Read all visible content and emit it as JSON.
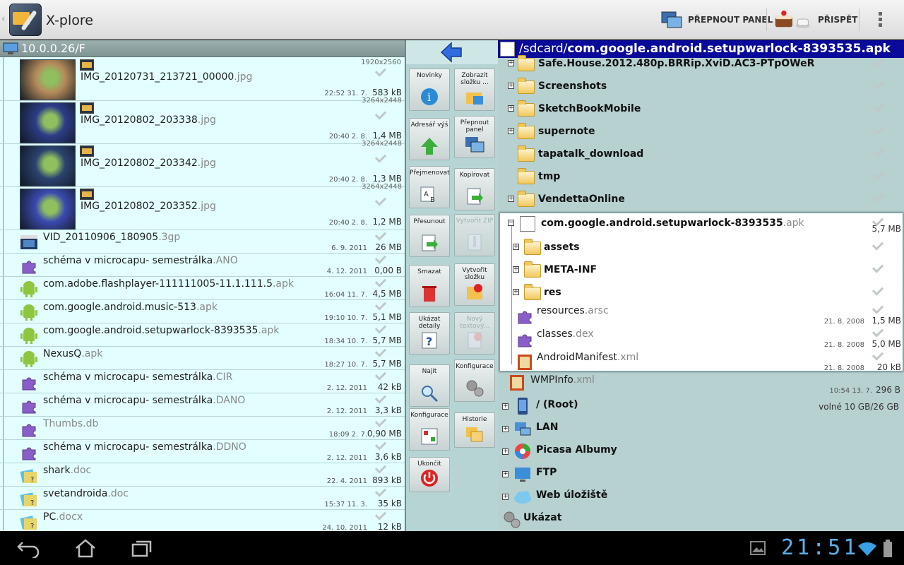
{
  "app": {
    "title": "X-plore"
  },
  "actionbar": {
    "switch_panel": "PŘEPNOUT PANEL",
    "donate": "PŘISPĚT"
  },
  "left_panel": {
    "path": "10.0.0.26/F",
    "top_resolution": "1920x2560",
    "rows": [
      {
        "name": "IMG_20120731_213721_00000",
        "ext": ".jpg",
        "date": "22:52 31. 7.",
        "size": "583 kB",
        "res": "3264x2448",
        "type": "photo"
      },
      {
        "name": "IMG_20120802_203338",
        "ext": ".jpg",
        "date": "20:40 2. 8.",
        "size": "1,4 MB",
        "res": "3264x2448",
        "type": "photo"
      },
      {
        "name": "IMG_20120802_203342",
        "ext": ".jpg",
        "date": "20:40 2. 8.",
        "size": "1,3 MB",
        "res": "3264x2448",
        "type": "photo"
      },
      {
        "name": "IMG_20120802_203352",
        "ext": ".jpg",
        "date": "20:40 2. 8.",
        "size": "1,2 MB",
        "res": "",
        "type": "photo"
      },
      {
        "name": "VID_20110906_180905",
        "ext": ".3gp",
        "date": "6. 9. 2011",
        "size": "26 MB",
        "type": "video"
      },
      {
        "name": "schéma v microcapu- semestrálka",
        "ext": ".ANO",
        "date": "4. 12. 2011",
        "size": "0,00 B",
        "type": "puzzle"
      },
      {
        "name": "com.adobe.flashplayer-111111005-11.1.111.5",
        "ext": ".apk",
        "date": "16:04 11. 7.",
        "size": "4,5 MB",
        "type": "android"
      },
      {
        "name": "com.google.android.music-513",
        "ext": ".apk",
        "date": "19:10 10. 7.",
        "size": "5,1 MB",
        "type": "android"
      },
      {
        "name": "com.google.android.setupwarlock-8393535",
        "ext": ".apk",
        "date": "18:34 10. 7.",
        "size": "5,7 MB",
        "type": "android"
      },
      {
        "name": "NexusQ",
        "ext": ".apk",
        "date": "18:27 10. 7.",
        "size": "5,7 MB",
        "type": "android"
      },
      {
        "name": "schéma v microcapu- semestrálka",
        "ext": ".CIR",
        "date": "2. 12. 2011",
        "size": "42 kB",
        "type": "puzzle"
      },
      {
        "name": "schéma v microcapu- semestrálka",
        "ext": ".DANO",
        "date": "2. 12. 2011",
        "size": "3,3 kB",
        "type": "puzzle"
      },
      {
        "name": "Thumbs.db",
        "ext": "",
        "date": "18:09 2. 7.",
        "size": "0,90 MB",
        "type": "puzzle",
        "dim": true
      },
      {
        "name": "schéma v microcapu- semestrálka",
        "ext": ".DDNO",
        "date": "2. 12. 2011",
        "size": "3,6 kB",
        "type": "puzzle"
      },
      {
        "name": "shark",
        "ext": ".doc",
        "date": "22. 4. 2011",
        "size": "893 kB",
        "type": "doc"
      },
      {
        "name": "svetandroida",
        "ext": ".doc",
        "date": "15:37 11. 3.",
        "size": "35 kB",
        "type": "doc"
      },
      {
        "name": "PC",
        "ext": ".docx",
        "date": "24. 10. 2011",
        "size": "12 kB",
        "type": "doc"
      }
    ]
  },
  "toolbar": {
    "left": [
      {
        "label": "Novinky",
        "icon": "info-icon"
      },
      {
        "label": "Adresář výš",
        "icon": "up-arrow-icon"
      },
      {
        "label": "Přejmenovat",
        "icon": "rename-icon"
      },
      {
        "label": "Přesunout",
        "icon": "move-icon"
      },
      {
        "label": "Smazat",
        "icon": "trash-icon"
      },
      {
        "label": "Ukázat detaily",
        "icon": "help-icon"
      },
      {
        "label": "Najít",
        "icon": "search-icon"
      },
      {
        "label": "Konfigurace",
        "icon": "config-icon"
      },
      {
        "label": "Ukončit",
        "icon": "power-icon"
      }
    ],
    "right": [
      {
        "label": "Zobrazit složku ...",
        "icon": "folder-view-icon",
        "disabled": false
      },
      {
        "label": "Přepnout panel",
        "icon": "switch-panel-icon",
        "disabled": false
      },
      {
        "label": "Kopírovat",
        "icon": "copy-icon",
        "disabled": false
      },
      {
        "label": "Vytvořit ZIP",
        "icon": "zip-icon",
        "disabled": true
      },
      {
        "label": "Vytvořit složku",
        "icon": "new-folder-icon",
        "disabled": false
      },
      {
        "label": "Nový textový...",
        "icon": "new-text-icon",
        "disabled": true
      },
      {
        "label": "Konfigurace",
        "icon": "gears-icon",
        "disabled": false
      },
      {
        "label": "Historie",
        "icon": "history-icon",
        "disabled": false
      }
    ]
  },
  "right_panel": {
    "path_prefix": "/sdcard/",
    "path_bold": "com.google.android.setupwarlock-8393535.apk",
    "folders": [
      "Safe.House.2012.480p.BRRip.XviD.AC3-PTpOWeR",
      "Screenshots",
      "SketchBookMobile",
      "supernote",
      "tapatalk_download",
      "tmp",
      "VendettaOnline"
    ],
    "apk": {
      "name": "com.google.android.setupwarlock-8393535",
      "ext": ".apk",
      "size": "5,7 MB",
      "folders": [
        "assets",
        "META-INF",
        "res"
      ],
      "files": [
        {
          "name": "resources",
          "ext": ".arsc",
          "date": "21. 8. 2008",
          "size": "1,5 MB"
        },
        {
          "name": "classes",
          "ext": ".dex",
          "date": "21. 8. 2008",
          "size": "5,0 MB"
        },
        {
          "name": "AndroidManifest",
          "ext": ".xml",
          "date": "21. 8. 2008",
          "size": "20 kB"
        }
      ]
    },
    "wmp": {
      "name": "WMPInfo",
      "ext": ".xml",
      "date": "10:54 13. 7.",
      "size": "296 B"
    },
    "roots": [
      {
        "label": "/ (Root)",
        "info": "volné 10 GB/26 GB",
        "icon": "phone-icon"
      },
      {
        "label": "LAN",
        "info": "",
        "icon": "lan-icon"
      },
      {
        "label": "Picasa Albumy",
        "info": "",
        "icon": "picasa-icon"
      },
      {
        "label": "FTP",
        "info": "",
        "icon": "ftp-icon"
      },
      {
        "label": "Web úložiště",
        "info": "",
        "icon": "cloud-icon"
      },
      {
        "label": "Ukázat",
        "info": "",
        "icon": "gears-icon"
      }
    ]
  },
  "statusbar": {
    "clock": "21:51"
  }
}
